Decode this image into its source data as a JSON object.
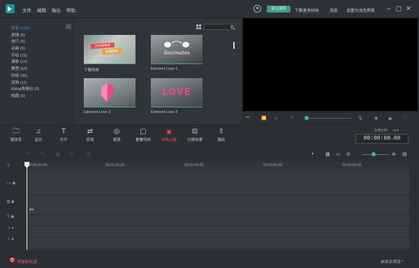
{
  "menu": [
    "文件",
    "编辑",
    "输出",
    "帮助"
  ],
  "titlebar": {
    "register": "请注册账",
    "download": "下载更多特效",
    "messages": "消息",
    "set_ui": "设置为浅色界面"
  },
  "categories": [
    {
      "label": "所有 (127)",
      "active": true
    },
    {
      "label": "爱情 (6)"
    },
    {
      "label": "旅行 (6)"
    },
    {
      "label": "动画 (6)"
    },
    {
      "label": "手绘 (21)"
    },
    {
      "label": "潮拿 (12)"
    },
    {
      "label": "教程 (64)"
    },
    {
      "label": "网络 (36)"
    },
    {
      "label": "宠物 (11)"
    },
    {
      "label": "EMoji表情包 (9)"
    },
    {
      "label": "晚霞 (6)"
    }
  ],
  "library": {
    "items": [
      {
        "label": "下载特效",
        "thumb_text_1": "万代特殊字",
        "thumb_text_2": "资源商城"
      },
      {
        "label": "Element Love 1",
        "thumb_text_1": "Soulmates"
      },
      {
        "label": "Element Love 2"
      },
      {
        "label": "Element Love 3",
        "thumb_text_1": "LOVE"
      }
    ]
  },
  "toolbar": {
    "tools": [
      {
        "label": "媒体库",
        "icon": "folder-icon"
      },
      {
        "label": "音乐",
        "icon": "music-icon"
      },
      {
        "label": "文字",
        "icon": "text-icon"
      },
      {
        "label": "转场",
        "icon": "transition-icon"
      },
      {
        "label": "滤镜",
        "icon": "filter-icon"
      },
      {
        "label": "叠覆特效",
        "icon": "overlay-icon"
      },
      {
        "label": "动画元素",
        "icon": "element-icon",
        "active": true
      },
      {
        "label": "分屏效果",
        "icon": "split-icon"
      },
      {
        "label": "输出",
        "icon": "export-icon"
      }
    ],
    "ratio_a": "主要比例：",
    "ratio_b": "16:9",
    "timecode": "00:00:00.00"
  },
  "ruler": [
    "00:00:00:00",
    "00:01:00:00",
    "00:02:00:00",
    "00:03:00:00",
    "00:04:00:00"
  ],
  "status": {
    "add_track": "添加新轨道",
    "project_name": "未命名项目 *"
  },
  "colors": {
    "accent": "#3ab3a9",
    "active_tool": "#e84b57",
    "category_active": "#4c8fe0"
  }
}
